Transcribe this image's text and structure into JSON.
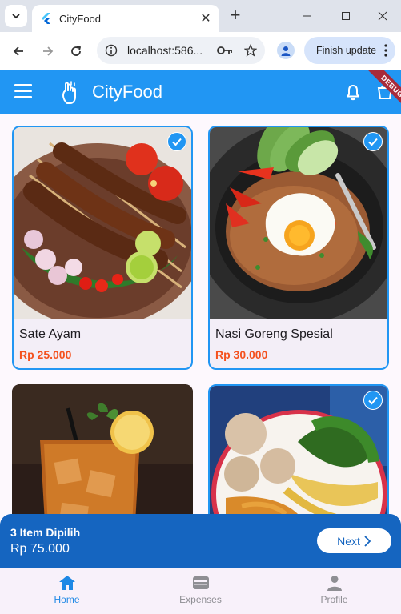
{
  "browser": {
    "tab_title": "CityFood",
    "url": "localhost:586...",
    "update_label": "Finish update"
  },
  "appbar": {
    "title": "CityFood",
    "debug_label": "DEBUG"
  },
  "products": [
    {
      "name": "Sate Ayam",
      "price": "Rp 25.000",
      "selected": true
    },
    {
      "name": "Nasi Goreng Spesial",
      "price": "Rp 30.000",
      "selected": true
    },
    {
      "name": "",
      "price": "",
      "selected": false
    },
    {
      "name": "",
      "price": "",
      "selected": true
    }
  ],
  "selection": {
    "count_label": "3 Item Dipilih",
    "total": "Rp 75.000",
    "next_label": "Next"
  },
  "bottom_nav": [
    {
      "label": "Home",
      "icon": "home-icon",
      "active": true
    },
    {
      "label": "Expenses",
      "icon": "wallet-icon",
      "active": false
    },
    {
      "label": "Profile",
      "icon": "person-icon",
      "active": false
    }
  ],
  "colors": {
    "primary": "#2196f3",
    "dark_primary": "#1565c0",
    "price": "#f4511e"
  }
}
